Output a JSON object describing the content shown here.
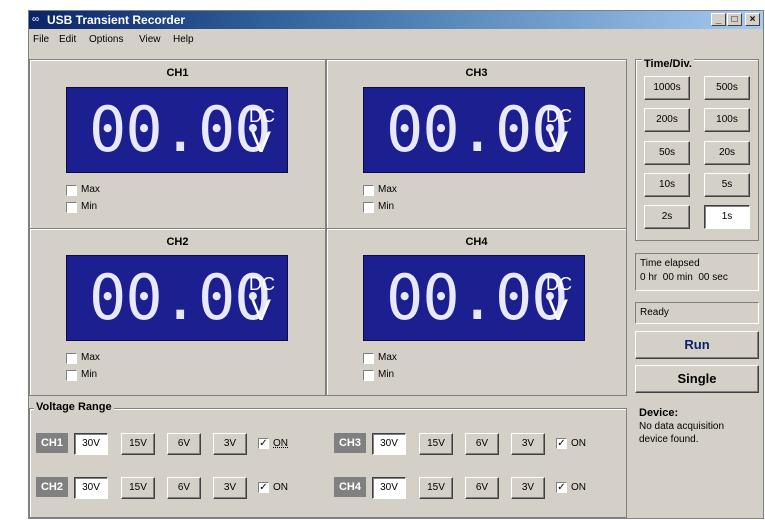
{
  "window": {
    "title": "USB Transient Recorder",
    "icon": "app-icon",
    "min": "_",
    "max": "□",
    "close": "×"
  },
  "menu": [
    "File",
    "Edit",
    "Options",
    "View",
    "Help"
  ],
  "channels": [
    {
      "title": "CH1",
      "value": "00.00",
      "coupling": "DC",
      "unit": "V",
      "max_label": "Max",
      "min_label": "Min"
    },
    {
      "title": "CH3",
      "value": "00.00",
      "coupling": "DC",
      "unit": "V",
      "max_label": "Max",
      "min_label": "Min"
    },
    {
      "title": "CH2",
      "value": "00.00",
      "coupling": "DC",
      "unit": "V",
      "max_label": "Max",
      "min_label": "Min"
    },
    {
      "title": "CH4",
      "value": "00.00",
      "coupling": "DC",
      "unit": "V",
      "max_label": "Max",
      "min_label": "Min"
    }
  ],
  "timediv": {
    "title": "Time/Div.",
    "buttons": [
      "1000s",
      "500s",
      "200s",
      "100s",
      "50s",
      "20s",
      "10s",
      "5s",
      "2s",
      "1s"
    ],
    "selected": "1s"
  },
  "status": {
    "elapsed_label": "Time elapsed",
    "elapsed_value": "0 hr  00 min  00 sec",
    "state": "Ready"
  },
  "actions": {
    "run": "Run",
    "single": "Single"
  },
  "voltage": {
    "title": "Voltage Range",
    "ranges": [
      "30V",
      "15V",
      "6V",
      "3V"
    ],
    "rows": [
      {
        "ch": "CH1",
        "on_label": "ON",
        "on": true
      },
      {
        "ch": "CH3",
        "on_label": "ON",
        "on": true
      },
      {
        "ch": "CH2",
        "on_label": "ON",
        "on": true
      },
      {
        "ch": "CH4",
        "on_label": "ON",
        "on": true
      }
    ]
  },
  "device": {
    "label": "Device:",
    "text1": "No data acquisition",
    "text2": "device found."
  },
  "check_mark": "✓"
}
